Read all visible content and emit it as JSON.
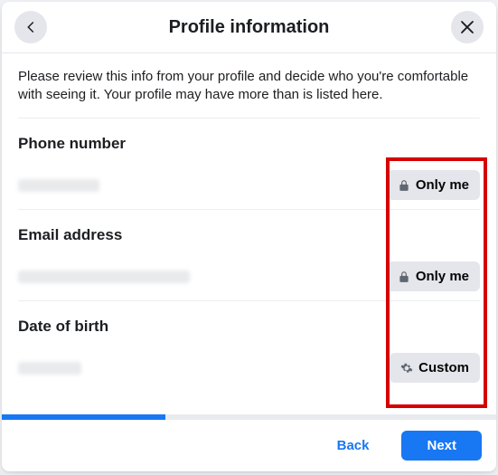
{
  "header": {
    "title": "Profile information"
  },
  "intro": "Please review this info from your profile and decide who you're comfortable with seeing it. Your profile may have more than is listed here.",
  "sections": {
    "phone": {
      "label": "Phone number",
      "privacy": "Only me"
    },
    "email": {
      "label": "Email address",
      "privacy": "Only me"
    },
    "dob": {
      "label": "Date of birth",
      "privacy": "Custom"
    }
  },
  "footer": {
    "back": "Back",
    "next": "Next"
  },
  "progress_percent": 33
}
